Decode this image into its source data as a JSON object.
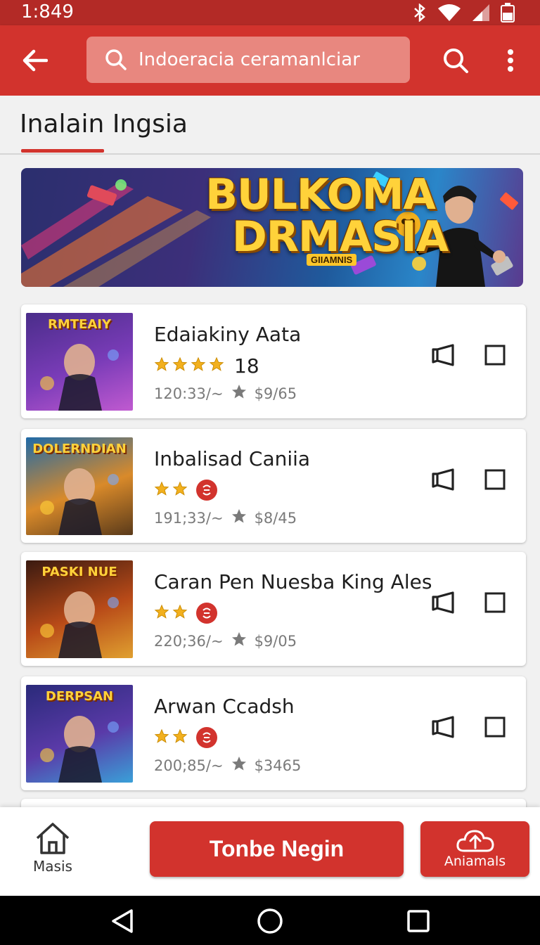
{
  "status_bar": {
    "time": "1:849",
    "icons": [
      "bluetooth-icon",
      "wifi-icon",
      "signal-icon",
      "battery-icon"
    ]
  },
  "app_bar": {
    "back_icon": "arrow-left-icon",
    "search_placeholder": "Indoeracia ceramanlciar",
    "search_icon": "search-icon",
    "more_icon": "more-vert-icon"
  },
  "section": {
    "title": "Inalain Ingsia"
  },
  "banner": {
    "title_line1": "BULKOMA",
    "title_line2": "DRMASIA",
    "subtitle": "GIIAMNIS"
  },
  "games": [
    {
      "name": "Edaiakiny Aata",
      "stars": 4,
      "rating_count": "18",
      "has_badge": false,
      "downloads": "120:33/~",
      "price": "$9/65",
      "thumb_caption": "RMTEAIY",
      "thumb_colors": [
        "#4a2d8a",
        "#7a3cb8",
        "#c05ad0"
      ]
    },
    {
      "name": "Inbalisad Caniia",
      "stars": 2,
      "rating_count": "",
      "has_badge": true,
      "downloads": "191;33/~",
      "price": "$8/45",
      "thumb_caption": "DOLERNDIAN",
      "thumb_colors": [
        "#1f6aa8",
        "#d98a2a",
        "#5a3a1a"
      ]
    },
    {
      "name": "Caran Pen Nuesba King Ales",
      "stars": 2,
      "rating_count": "",
      "has_badge": true,
      "downloads": "220;36/~",
      "price": "$9/05",
      "thumb_caption": "PASKI NUE",
      "thumb_colors": [
        "#3a1a10",
        "#b84a18",
        "#e0a030"
      ]
    },
    {
      "name": "Arwan Ccadsh",
      "stars": 2,
      "rating_count": "",
      "has_badge": true,
      "downloads": "200;85/~",
      "price": "$3465",
      "thumb_caption": "DERPSAN",
      "thumb_colors": [
        "#2a2a7a",
        "#5a3aa8",
        "#3aa0d8"
      ]
    }
  ],
  "bottom_bar": {
    "home_label": "Masis",
    "home_icon": "home-icon",
    "primary_button": "Tonbe Negin",
    "secondary_label": "Aniamals",
    "secondary_icon": "cloud-upload-icon"
  },
  "system_nav": {
    "icons": [
      "back-triangle-icon",
      "home-circle-icon",
      "recents-square-icon"
    ]
  },
  "colors": {
    "primary": "#d2332d",
    "status_bar": "#b32a26",
    "star": "#f2b01e"
  }
}
